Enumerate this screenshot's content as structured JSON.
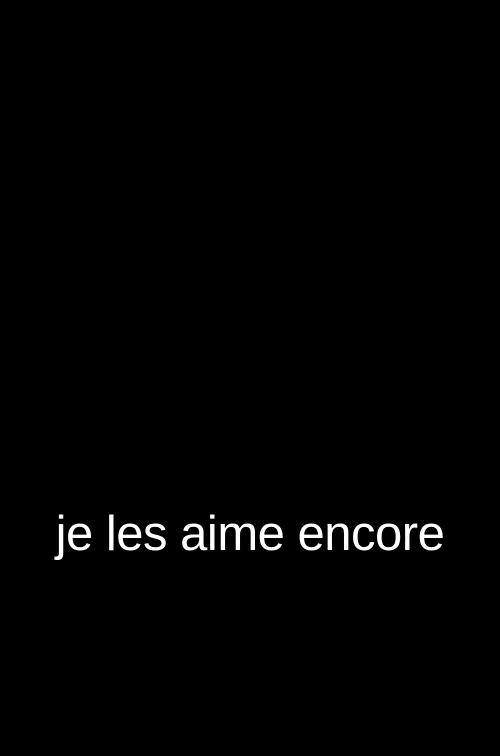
{
  "subtitle": {
    "text": "je les aime encore"
  },
  "colors": {
    "background": "#000000",
    "text": "#ffffff"
  }
}
